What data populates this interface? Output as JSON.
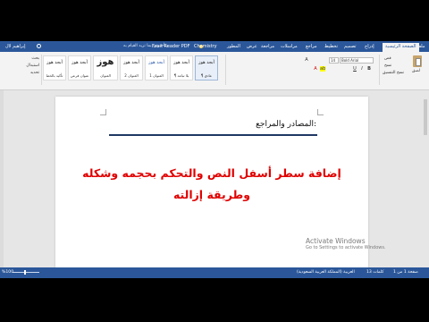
{
  "tabs": [
    {
      "label": "ملف"
    },
    {
      "label": "الصفحة الرئيسية",
      "active": true
    },
    {
      "label": "إدراج"
    },
    {
      "label": "تصميم"
    },
    {
      "label": "تخطيط"
    },
    {
      "label": "مراجع"
    },
    {
      "label": "مراسلات"
    },
    {
      "label": "مراجعة"
    },
    {
      "label": "عرض"
    },
    {
      "label": "المطور"
    },
    {
      "label": "Chemistry"
    },
    {
      "label": "Foxit Reader PDF"
    }
  ],
  "tell_me": "أخبرني بما تريد القيام به...",
  "user": "إبراهيم لال",
  "clipboard": {
    "paste": "لصق",
    "cut": "قص",
    "copy": "نسخ",
    "format_painter": "نسخ التنسيق"
  },
  "font": {
    "name": "Bold Arial",
    "size": "14"
  },
  "styles": [
    {
      "sample": "أبجد هوز",
      "name": "¶ عادي",
      "selected": true
    },
    {
      "sample": "أبجد هوز",
      "name": "¶ بلا تباعد"
    },
    {
      "sample": "أبجد هوز",
      "name": "العنوان 1",
      "blue": true
    },
    {
      "sample": "أبجد هوز",
      "name": "العنوان 2"
    },
    {
      "sample": "هوز",
      "name": "العنوان",
      "big": true
    },
    {
      "sample": "أبجد هوز",
      "name": "عنوان فرعي"
    },
    {
      "sample": "أبجد هوز",
      "name": "تأكيد بالخط"
    }
  ],
  "editing": {
    "find": "بحث",
    "replace": "استبدال",
    "select": "تحديد"
  },
  "document": {
    "heading": "المصادر  والمراجع:",
    "title_line1": "إضافة سطر أسفل النص والتحكم بحجمه وشكله",
    "title_line2": "وطريقة إزالته"
  },
  "watermark": {
    "line1": "Activate Windows",
    "line2": "Go to Settings to activate Windows."
  },
  "status": {
    "page": "صفحة 1 من 1",
    "words": "13 كلمات",
    "language": "العربية (المملكة العربية السعودية)",
    "zoom": "%100"
  }
}
